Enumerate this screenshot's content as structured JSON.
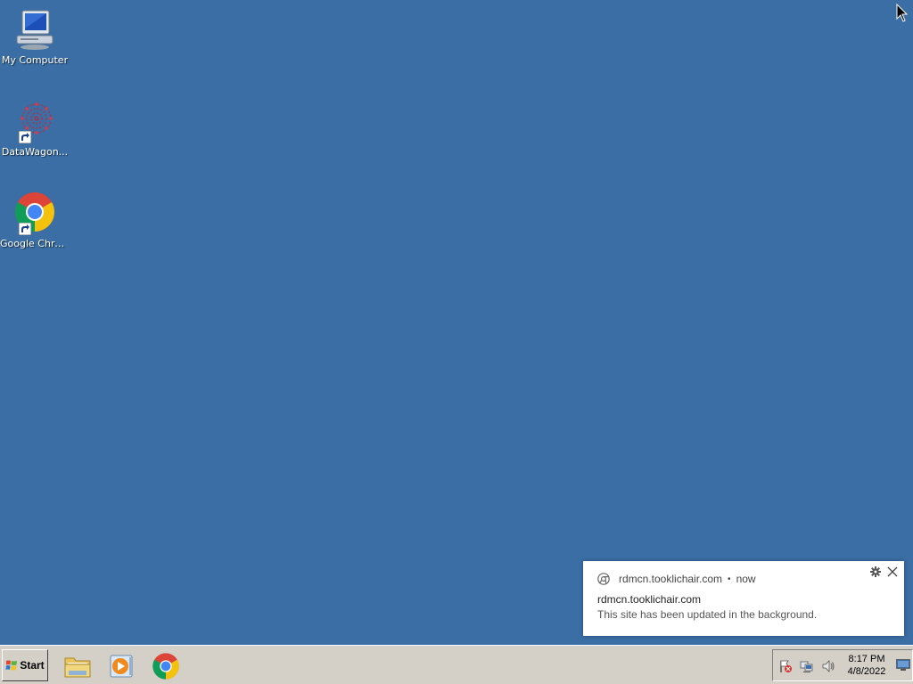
{
  "desktop": {
    "icons": [
      {
        "label": "My Computer",
        "icon": "my-computer-icon"
      },
      {
        "label": "DataWagon...",
        "icon": "datawagon-icon"
      },
      {
        "label": "Google Chrome",
        "icon": "chrome-icon"
      }
    ]
  },
  "notification": {
    "source": "rdmcn.tooklichair.com",
    "separator": "•",
    "time": "now",
    "title": "rdmcn.tooklichair.com",
    "body": "This site has been updated in the background."
  },
  "taskbar": {
    "start_label": "Start",
    "pinned": [
      {
        "name": "file-explorer",
        "icon": "folder-icon"
      },
      {
        "name": "media-player",
        "icon": "media-player-icon"
      },
      {
        "name": "google-chrome",
        "icon": "chrome-icon"
      }
    ],
    "tray": {
      "time": "8:17 PM",
      "date": "4/8/2022"
    }
  },
  "colors": {
    "desktop_background": "#3a6ea5",
    "taskbar": "#d4d0c8",
    "notification_bg": "#ffffff"
  }
}
